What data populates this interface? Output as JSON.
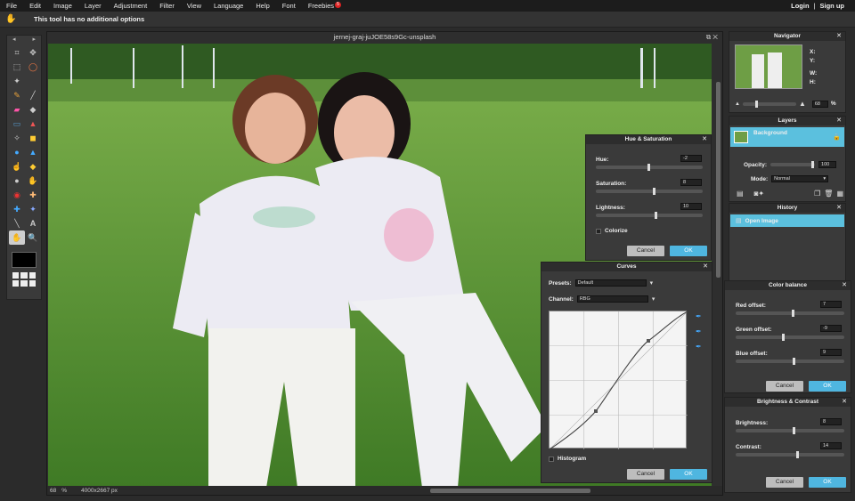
{
  "menu": {
    "items": [
      "File",
      "Edit",
      "Image",
      "Layer",
      "Adjustment",
      "Filter",
      "View",
      "Language",
      "Help",
      "Font",
      "Freebies"
    ],
    "freebies_badge": "5",
    "login": "Login",
    "separator": "|",
    "signup": "Sign up"
  },
  "options_bar": {
    "text": "This tool has no additional options"
  },
  "toolbox": {
    "arrows": [
      "◂",
      "▸"
    ]
  },
  "canvas": {
    "title": "jernej-graj-juJOE58s9Gc-unsplash",
    "zoom": "68",
    "zoom_unit": "%",
    "dimensions": "4000x2667 px"
  },
  "navigator": {
    "title": "Navigator",
    "x_label": "X:",
    "y_label": "Y:",
    "w_label": "W:",
    "h_label": "H:",
    "zoom": "68",
    "zoom_unit": "%"
  },
  "layers": {
    "title": "Layers",
    "layer_name": "Background",
    "opacity_label": "Opacity:",
    "opacity_value": "100",
    "mode_label": "Mode:",
    "mode_value": "Normal"
  },
  "history": {
    "title": "History",
    "item": "Open Image"
  },
  "hue_sat": {
    "title": "Hue & Saturation",
    "hue_label": "Hue:",
    "hue_value": "-2",
    "sat_label": "Saturation:",
    "sat_value": "8",
    "light_label": "Lightness:",
    "light_value": "10",
    "colorize_label": "Colorize",
    "cancel": "Cancel",
    "ok": "OK"
  },
  "curves": {
    "title": "Curves",
    "presets_label": "Presets:",
    "presets_value": "Default",
    "channel_label": "Channel:",
    "channel_value": "RBG",
    "histogram_label": "Histogram",
    "cancel": "Cancel",
    "ok": "OK"
  },
  "color_balance": {
    "title": "Color balance",
    "red_label": "Red offset:",
    "red_value": "7",
    "green_label": "Green offset:",
    "green_value": "-9",
    "blue_label": "Blue offset:",
    "blue_value": "9",
    "cancel": "Cancel",
    "ok": "OK"
  },
  "brightness_contrast": {
    "title": "Brightness & Contrast",
    "brightness_label": "Brightness:",
    "brightness_value": "8",
    "contrast_label": "Contrast:",
    "contrast_value": "14",
    "cancel": "Cancel",
    "ok": "OK"
  },
  "close_glyph": "✕",
  "colors": {
    "accent": "#4fb6e0",
    "layer_selected": "#5bc0de",
    "badge": "#dd2222"
  }
}
